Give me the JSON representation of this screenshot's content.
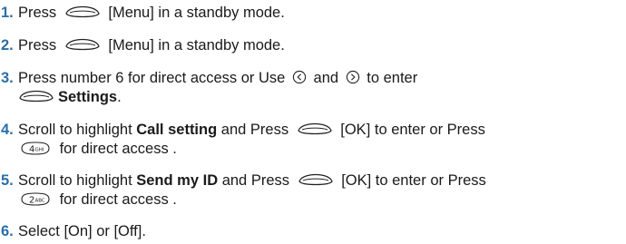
{
  "steps": [
    {
      "number": "1.",
      "press": "Press",
      "menu_label": "[Menu] in a standby mode."
    },
    {
      "number": "2.",
      "press": "Press",
      "menu_label": "[Menu] in a standby mode."
    },
    {
      "number": "3.",
      "text_a": "Press number 6 for direct access or Use",
      "text_and": "and",
      "text_b": "to enter",
      "settings": "Settings",
      "period": "."
    },
    {
      "number": "4.",
      "text_a": "Scroll to highlight",
      "target": "Call setting",
      "text_b": "and Press",
      "text_c": "[OK] to enter or Press",
      "key_digit": "4",
      "key_letters": "GHI",
      "text_d": "for direct access ."
    },
    {
      "number": "5.",
      "text_a": "Scroll to highlight",
      "target": "Send my ID",
      "text_b": "and Press",
      "text_c": "[OK] to enter or Press",
      "key_digit": "2",
      "key_letters": "ABC",
      "text_d": "for direct access ."
    },
    {
      "number": "6.",
      "text": "Select [On] or [Off]."
    }
  ],
  "icons": {
    "menu_key": "menu-soft-key-icon",
    "left_key": "left-nav-key-icon",
    "right_key": "right-nav-key-icon",
    "number_key": "number-key-icon"
  },
  "colors": {
    "step_number": "#2a6fa8",
    "text": "#1a1a1a"
  }
}
